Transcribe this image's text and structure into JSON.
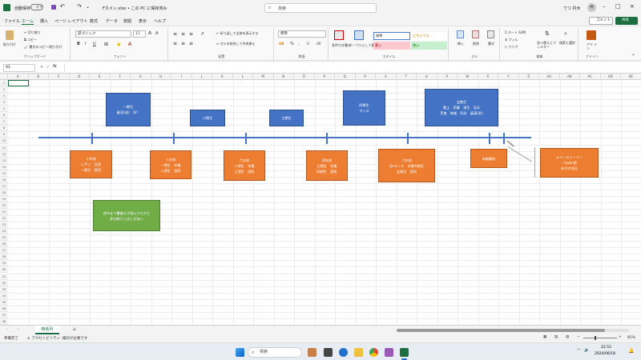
{
  "titlebar": {
    "autosave_label": "自動保存",
    "autosave_state": "オフ",
    "filename": "Fカメン.xlsx • この PC に保存済み",
    "search_placeholder": "検索",
    "user_name": "てつ 村木",
    "user_initials": "村"
  },
  "menu": {
    "items": [
      "ファイル",
      "ホーム",
      "挿入",
      "ページ レイアウト",
      "数式",
      "データ",
      "校閲",
      "表示",
      "ヘルプ"
    ],
    "active": "ホーム",
    "comment_label": "コメント",
    "share_label": "共有"
  },
  "ribbon": {
    "clipboard": {
      "paste": "貼り付け",
      "cut": "切り取り",
      "copy": "コピー",
      "format_painter": "書式のコピー/貼り付け",
      "label": "クリップボード"
    },
    "font": {
      "name": "游ゴシック",
      "size": "11",
      "label": "フォント",
      "bold": "B",
      "italic": "I",
      "underline": "U"
    },
    "alignment": {
      "wrap": "折り返して全体を表示する",
      "merge": "セルを結合して中央揃え",
      "label": "配置"
    },
    "number": {
      "format": "標準",
      "label": "数値"
    },
    "styles": {
      "conditional": "条件付き書式",
      "table": "テーブルとして書式設定",
      "cells": [
        "標準",
        "どちらでも...",
        "悪い",
        "良い"
      ],
      "label": "スタイル"
    },
    "cells_group": {
      "insert": "挿入",
      "delete": "削除",
      "format": "書式",
      "label": "セル"
    },
    "editing": {
      "autosum": "オート SUM",
      "fill": "フィル",
      "clear": "クリア",
      "sort": "並べ替えとフィルター",
      "find": "検索と選択",
      "label": "編集"
    },
    "addins": {
      "label": "アドイン",
      "btn": "アド イン"
    }
  },
  "formula": {
    "cell_ref": "A1",
    "fx": "fx",
    "value": ""
  },
  "columns": [
    "A",
    "B",
    "C",
    "D",
    "E",
    "F",
    "G",
    "H",
    "I",
    "J",
    "K",
    "L",
    "M",
    "N",
    "O",
    "P",
    "Q",
    "R",
    "S",
    "T",
    "U",
    "V",
    "W",
    "X",
    "Y",
    "Z",
    "AA",
    "AB",
    "AC",
    "AD",
    "AE"
  ],
  "rows": [
    "1",
    "2",
    "3",
    "4",
    "5",
    "6",
    "7",
    "8",
    "9",
    "10",
    "11",
    "12",
    "13",
    "14",
    "15",
    "16",
    "17",
    "18",
    "19",
    "20",
    "21",
    "22",
    "23",
    "24",
    "25",
    "26",
    "27",
    "28",
    "29",
    "30",
    "31",
    "32",
    "33",
    "34",
    "35",
    "36",
    "37",
    "38"
  ],
  "shapes": {
    "blue1": {
      "title": "一期生",
      "body": "蒼羽(成)　洋？"
    },
    "blue2": {
      "title": "二期生"
    },
    "blue3": {
      "title": "三期生"
    },
    "blue4": {
      "title": "四期生",
      "body": "ランス"
    },
    "blue5": {
      "title": "五期生",
      "line1": "敷上　伊藤　湊生　深水",
      "line2": "荒鬼　神威　阿形　蒼瑛(男)"
    },
    "orange1": {
      "title": "十年前",
      "line1": "レサン　目西",
      "line2": "一期生　読所"
    },
    "orange2": {
      "title": "八年前",
      "line1": "一期生　卒業",
      "line2": "二期生　読所"
    },
    "orange3": {
      "title": "六年前",
      "line1": "二期生　卒業",
      "line2": "三期生　読所"
    },
    "orange4": {
      "title": "四年前",
      "line1": "三期生　卒業",
      "line2": "四期生　読所"
    },
    "orange5": {
      "title": "二年前",
      "line1": "Qvランス　卒業※解定",
      "line2": "五期生　読所"
    },
    "orange6": {
      "title": "本編開始"
    },
    "orange7": {
      "title": "メインストーリー",
      "line1": "一babn前",
      "line2": "先代の命日"
    },
    "green1": {
      "line1": "途中まで書誰せず読んでたから",
      "line2": "多分取りこぼしがあい"
    }
  },
  "sheets": {
    "tabs": [
      "時系列"
    ],
    "active": "時系列",
    "add": "+"
  },
  "status": {
    "ready": "準備完了",
    "accessibility": "アクセシビリティ: 検討が必要です",
    "zoom": "85%"
  },
  "taskbar": {
    "search_placeholder": "検索",
    "time": "22:52",
    "date": "2024/06/18"
  }
}
